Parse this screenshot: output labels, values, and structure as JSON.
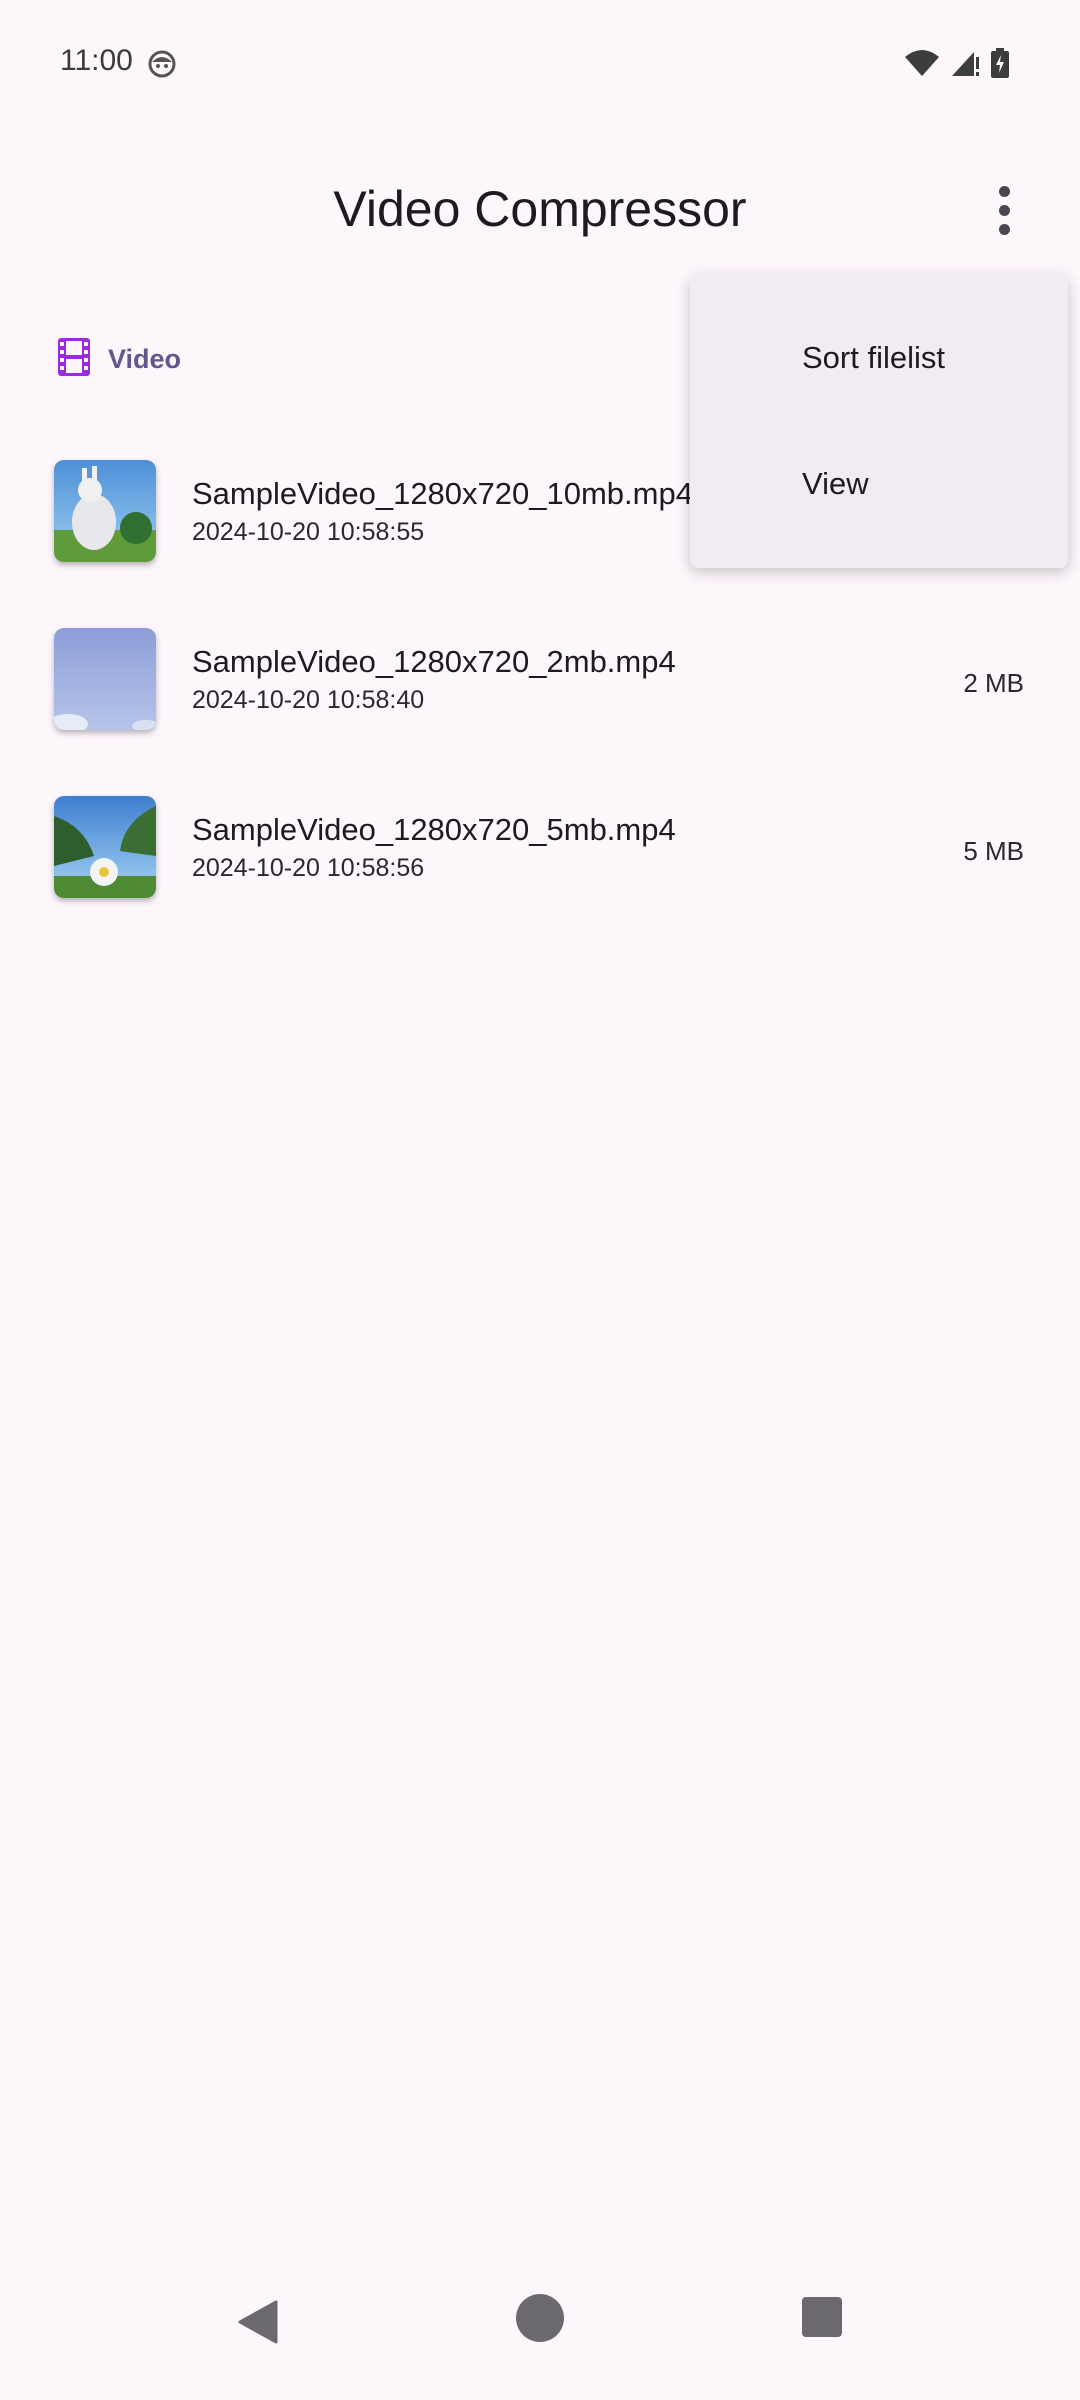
{
  "status_bar": {
    "time": "11:00"
  },
  "app_bar": {
    "title": "Video Compressor",
    "overflow_icon": "more-vert-icon"
  },
  "tab": {
    "label": "Video",
    "icon": "film-icon",
    "accent_color": "#9c2bde"
  },
  "files": [
    {
      "name": "SampleVideo_1280x720_10mb.mp4",
      "date": "2024-10-20 10:58:55",
      "size": ""
    },
    {
      "name": "SampleVideo_1280x720_2mb.mp4",
      "date": "2024-10-20 10:58:40",
      "size": "2 MB"
    },
    {
      "name": "SampleVideo_1280x720_5mb.mp4",
      "date": "2024-10-20 10:58:56",
      "size": "5 MB"
    }
  ],
  "menu": {
    "items": [
      {
        "label": "Sort filelist"
      },
      {
        "label": "View"
      }
    ]
  },
  "nav_bar": {
    "back_icon": "back-triangle-icon",
    "home_icon": "home-circle-icon",
    "recents_icon": "recents-square-icon"
  }
}
